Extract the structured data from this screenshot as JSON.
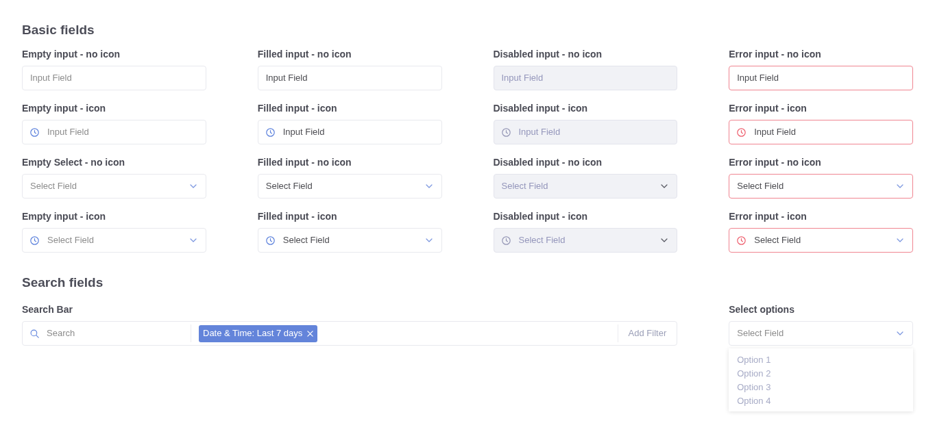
{
  "basic_fields": {
    "title": "Basic fields",
    "fields": [
      {
        "label": "Empty input - no icon",
        "kind": "input",
        "icon": false,
        "disabled": false,
        "error": false,
        "placeholder": "Input Field"
      },
      {
        "label": "Filled input - no icon",
        "kind": "input",
        "icon": false,
        "disabled": false,
        "error": false,
        "value": "Input Field"
      },
      {
        "label": "Disabled input - no icon",
        "kind": "input",
        "icon": false,
        "disabled": true,
        "error": false,
        "value": "Input Field"
      },
      {
        "label": "Error input - no icon",
        "kind": "input",
        "icon": false,
        "disabled": false,
        "error": true,
        "value": "Input Field"
      },
      {
        "label": "Empty input - icon",
        "kind": "input",
        "icon": true,
        "disabled": false,
        "error": false,
        "placeholder": "Input Field"
      },
      {
        "label": "Filled input - icon",
        "kind": "input",
        "icon": true,
        "disabled": false,
        "error": false,
        "value": "Input Field"
      },
      {
        "label": "Disabled input - icon",
        "kind": "input",
        "icon": true,
        "disabled": true,
        "error": false,
        "value": "Input Field"
      },
      {
        "label": "Error input - icon",
        "kind": "input",
        "icon": true,
        "disabled": false,
        "error": true,
        "value": "Input Field"
      },
      {
        "label": "Empty Select - no icon",
        "kind": "select",
        "icon": false,
        "disabled": false,
        "error": false,
        "placeholder": "Select Field"
      },
      {
        "label": "Filled input - no icon",
        "kind": "select",
        "icon": false,
        "disabled": false,
        "error": false,
        "value": "Select Field"
      },
      {
        "label": "Disabled input - no icon",
        "kind": "select",
        "icon": false,
        "disabled": true,
        "error": false,
        "value": "Select Field"
      },
      {
        "label": "Error input - no icon",
        "kind": "select",
        "icon": false,
        "disabled": false,
        "error": true,
        "value": "Select Field"
      },
      {
        "label": "Empty input - icon",
        "kind": "select",
        "icon": true,
        "disabled": false,
        "error": false,
        "placeholder": "Select Field"
      },
      {
        "label": "Filled input - icon",
        "kind": "select",
        "icon": true,
        "disabled": false,
        "error": false,
        "value": "Select Field"
      },
      {
        "label": "Disabled input - icon",
        "kind": "select",
        "icon": true,
        "disabled": true,
        "error": false,
        "value": "Select Field"
      },
      {
        "label": "Error input - icon",
        "kind": "select",
        "icon": true,
        "disabled": false,
        "error": true,
        "value": "Select Field"
      }
    ]
  },
  "search_fields": {
    "title": "Search fields",
    "search_bar": {
      "label": "Search Bar",
      "placeholder": "Search",
      "filters": [
        {
          "label": "Date & Time: Last 7 days"
        }
      ],
      "add_filter": "Add Filter"
    },
    "select_options": {
      "label": "Select options",
      "placeholder": "Select Field",
      "expanded": true,
      "options": [
        "Option 1",
        "Option 2",
        "Option 3",
        "Option 4"
      ]
    }
  }
}
